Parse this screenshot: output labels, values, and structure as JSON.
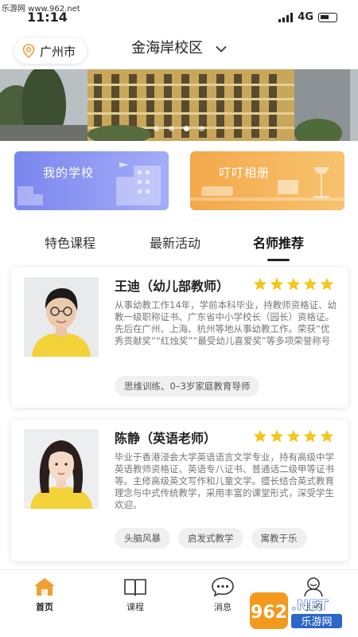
{
  "watermark": {
    "top_left": "乐游网 www.962.net"
  },
  "status_bar": {
    "time": "11:14",
    "network": "4G"
  },
  "header": {
    "city": "广州市",
    "campus": "金海岸校区"
  },
  "banner": {
    "slides": 4,
    "active_slide": 3
  },
  "quick_cards": [
    {
      "label": "我的学校",
      "color": "#8791f0"
    },
    {
      "label": "叮叮相册",
      "color": "#f4ac52"
    }
  ],
  "tabs": [
    {
      "label": "特色课程",
      "active": false
    },
    {
      "label": "最新活动",
      "active": false
    },
    {
      "label": "名师推荐",
      "active": true
    }
  ],
  "teachers": [
    {
      "name": "王迪（幼儿部教师）",
      "rating": 5,
      "description": "从事幼教工作14年，学前本科毕业，持教师资格证、幼教一级职称证书、广东省中小学校长（园长）资格证。先后在广州、上海、杭州等地从事幼教工作。荣获“优秀贡献奖”“红烛奖”“最受幼儿喜爱奖”等多项荣誉称号",
      "tags": [
        "思维训练、0–3岁家庭教育导师"
      ]
    },
    {
      "name": "陈静（英语老师）",
      "rating": 5,
      "description": "毕业于香港浸会大学英语语言文学专业，持有高级中学英语教师资格证、英语专八证书、普通话二级甲等证书等。主修高级英文写作和儿童文学。擅长结合英式教育理念与中式传统教学，采用丰富的课堂形式，深受学生欢迎。",
      "tags": [
        "头脑风暴",
        "启发式教学",
        "寓教于乐"
      ]
    }
  ],
  "bottom_nav": [
    {
      "label": "首页",
      "icon": "home-icon",
      "active": true
    },
    {
      "label": "课程",
      "icon": "book-icon",
      "active": false
    },
    {
      "label": "消息",
      "icon": "message-icon",
      "active": false
    },
    {
      "label": "我的",
      "icon": "profile-icon",
      "active": false
    }
  ],
  "brand_logo": {
    "number": "962",
    "suffix": ".NET",
    "sub": "乐游网"
  },
  "colors": {
    "star": "#f5c518",
    "home_active": "#f0a030",
    "school_card": "#8791f0",
    "album_card": "#f4ac52"
  }
}
